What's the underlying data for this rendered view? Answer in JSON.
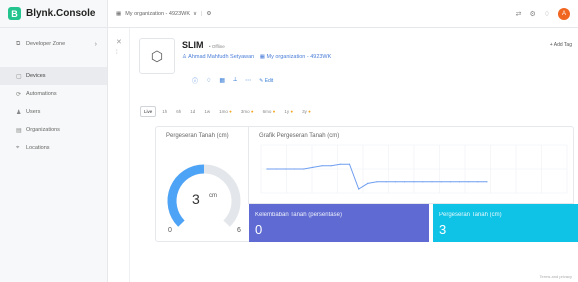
{
  "app": {
    "brand_logo": "B",
    "brand_name": "Blynk.Console"
  },
  "topbar": {
    "org_label": "My organization - 4923WK",
    "org_icon": "org-icon",
    "chevron": "∨",
    "separator": "|",
    "gear_glyph": "⚙",
    "icons": [
      "share-icon",
      "settings-icon",
      "bell-icon"
    ],
    "icon_glyphs": [
      "⇄",
      "⚙",
      "♢"
    ],
    "avatar_letter": "A"
  },
  "sidebar": {
    "developer_zone": {
      "label": "Developer Zone",
      "icon": "developer-zone-icon",
      "glyph": "⧉",
      "chevron": "›"
    },
    "items": [
      {
        "label": "Devices",
        "icon": "devices-icon",
        "glyph": "▢",
        "active": true
      },
      {
        "label": "Automations",
        "icon": "automations-icon",
        "glyph": "⟳",
        "active": false
      },
      {
        "label": "Users",
        "icon": "users-icon",
        "glyph": "♟",
        "active": false
      },
      {
        "label": "Organizations",
        "icon": "organizations-icon",
        "glyph": "▤",
        "active": false
      },
      {
        "label": "Locations",
        "icon": "locations-icon",
        "glyph": "⌖",
        "active": false
      }
    ]
  },
  "strip": {
    "close_glyph": "✕",
    "drag_glyph": "⁞"
  },
  "device": {
    "name": "SLIM",
    "status": "• Offline",
    "owner": "Ahmad Mahfudh Setyawan",
    "organization": "My organization - 4923WK",
    "owner_icon": "user-icon",
    "org_icon": "org-icon",
    "add_tag_label": "+ Add Tag",
    "edit_label": "Edit",
    "box_glyph": "⬡",
    "actions": [
      "info-icon",
      "bell-icon",
      "grid-icon",
      "chart-icon",
      "more-icon"
    ],
    "action_glyphs": [
      "ⓘ",
      "♢",
      "▦",
      "⟂",
      "⋯"
    ],
    "edit_icon": "pencil-icon",
    "edit_glyph": "✎"
  },
  "time_tabs": [
    {
      "label": "Live",
      "active": true,
      "dot": ""
    },
    {
      "label": "1h",
      "active": false,
      "dot": ""
    },
    {
      "label": "6h",
      "active": false,
      "dot": ""
    },
    {
      "label": "1d",
      "active": false,
      "dot": ""
    },
    {
      "label": "1w",
      "active": false,
      "dot": ""
    },
    {
      "label": "1mo",
      "active": false,
      "dot": "●"
    },
    {
      "label": "3mo",
      "active": false,
      "dot": "●"
    },
    {
      "label": "6mo",
      "active": false,
      "dot": "●"
    },
    {
      "label": "1y",
      "active": false,
      "dot": "●"
    },
    {
      "label": "3y",
      "active": false,
      "dot": "●"
    }
  ],
  "gauge": {
    "title": "Pergeseran Tanah (cm)",
    "value": "3",
    "unit": "cm",
    "min": "0",
    "max": "6",
    "fraction": 0.5,
    "colors": {
      "track": "#e3e6ea",
      "fill": "#4da3f5"
    }
  },
  "chart": {
    "title": "Grafik Pergeseran Tanah (cm)",
    "line_color": "#6f9ef0",
    "grid": true
  },
  "chart_data": {
    "type": "line",
    "title": "Grafik Pergeseran Tanah (cm)",
    "xlabel": "",
    "ylabel": "",
    "ylim": [
      0,
      6
    ],
    "series": [
      {
        "values": [
          3.0,
          3.0,
          3.0,
          3.0,
          3.0,
          3.2,
          3.4,
          3.4,
          3.6,
          3.6,
          0.5,
          1.2,
          1.4,
          1.4,
          1.4,
          1.4,
          1.4,
          1.4,
          1.4,
          1.4,
          1.4,
          1.4,
          1.4,
          1.4,
          1.4
        ]
      }
    ]
  },
  "tiles": {
    "moisture": {
      "label": "Kelembaban Tanah (persentase)",
      "value": "0",
      "color": "#5f6bd3"
    },
    "displacement": {
      "label": "Pergeseran Tanah (cm)",
      "value": "3",
      "color": "#0fc3e6"
    }
  },
  "footer": {
    "note": "Terms and privacy"
  }
}
